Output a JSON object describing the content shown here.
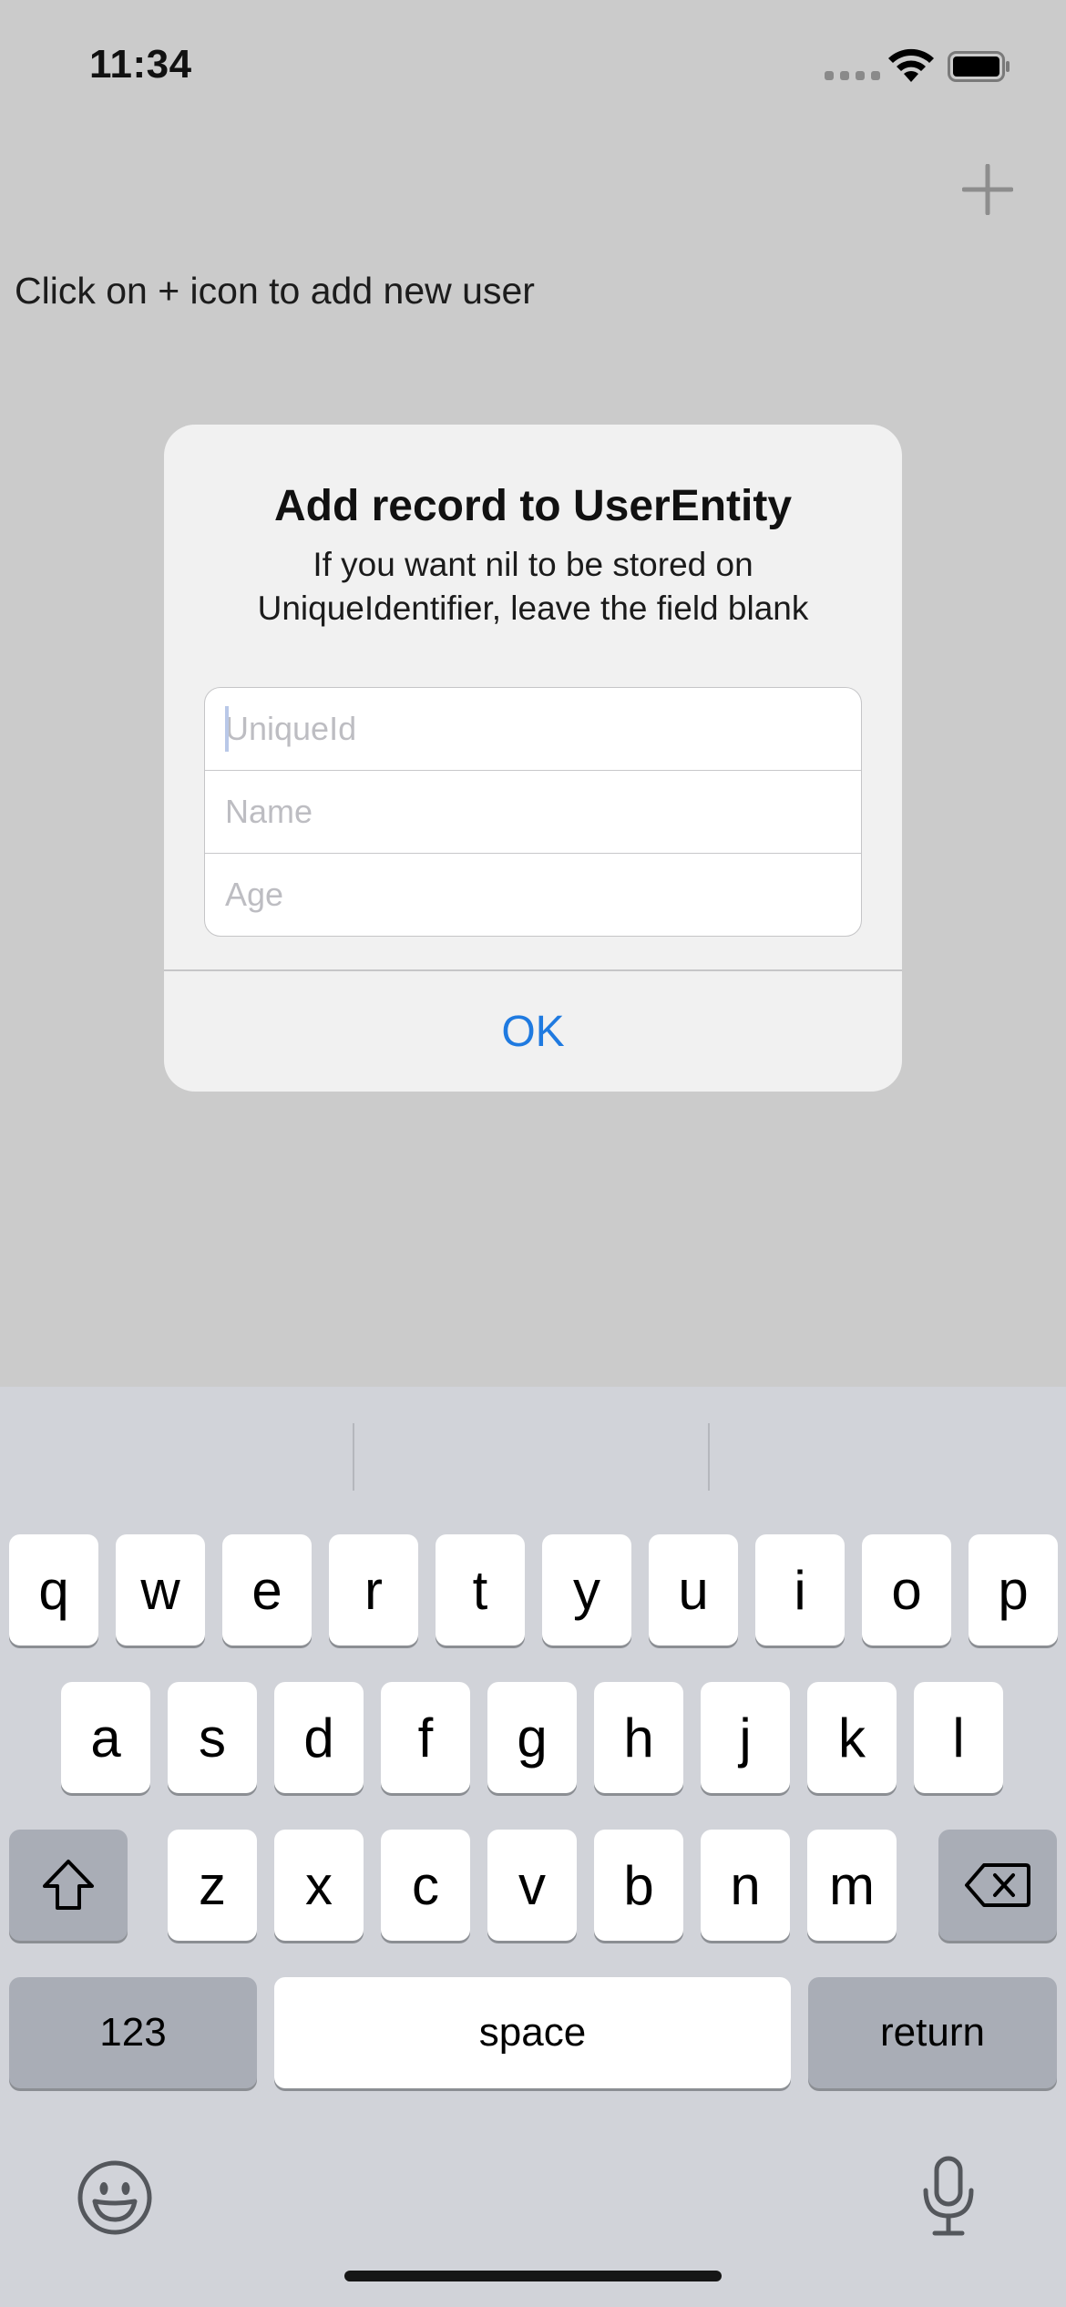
{
  "status_bar": {
    "time": "11:34"
  },
  "screen": {
    "hint_text": "Click on + icon to add new user"
  },
  "alert": {
    "title": "Add record to UserEntity",
    "message": "If you want nil to be stored on UniqueIdentifier, leave the field blank",
    "fields": [
      {
        "placeholder": "UniqueId",
        "value": ""
      },
      {
        "placeholder": "Name",
        "value": ""
      },
      {
        "placeholder": "Age",
        "value": ""
      }
    ],
    "ok_label": "OK",
    "ok_color": "#1f7ae0"
  },
  "keyboard": {
    "row1": [
      "q",
      "w",
      "e",
      "r",
      "t",
      "y",
      "u",
      "i",
      "o",
      "p"
    ],
    "row2": [
      "a",
      "s",
      "d",
      "f",
      "g",
      "h",
      "j",
      "k",
      "l"
    ],
    "row3": [
      "z",
      "x",
      "c",
      "v",
      "b",
      "n",
      "m"
    ],
    "numbers_label": "123",
    "space_label": "space",
    "return_label": "return",
    "icons": [
      "shift-icon",
      "delete-icon",
      "emoji-icon",
      "microphone-icon"
    ]
  }
}
